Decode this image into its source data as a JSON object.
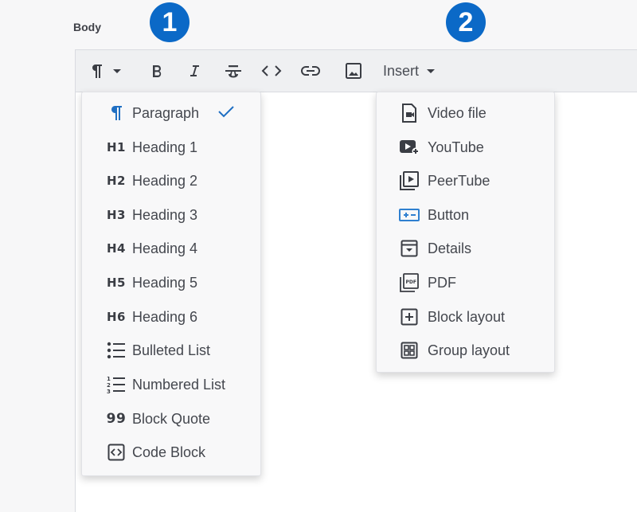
{
  "field": {
    "label": "Body"
  },
  "badges": [
    "1",
    "2"
  ],
  "toolbar": {
    "insert_label": "Insert",
    "buttons": [
      "paragraph-format-dropdown",
      "bold",
      "italic",
      "strikethrough",
      "inline-code",
      "link",
      "image",
      "insert-dropdown"
    ]
  },
  "format_menu": {
    "selected": "Paragraph",
    "items": [
      {
        "label": "Paragraph",
        "icon": "pilcrow-icon",
        "selected": true
      },
      {
        "label": "Heading 1",
        "icon": "H1"
      },
      {
        "label": "Heading 2",
        "icon": "H2"
      },
      {
        "label": "Heading 3",
        "icon": "H3"
      },
      {
        "label": "Heading 4",
        "icon": "H4"
      },
      {
        "label": "Heading 5",
        "icon": "H5"
      },
      {
        "label": "Heading 6",
        "icon": "H6"
      },
      {
        "label": "Bulleted List",
        "icon": "bulleted-list-icon"
      },
      {
        "label": "Numbered List",
        "icon": "numbered-list-icon"
      },
      {
        "label": "Block Quote",
        "icon": "99"
      },
      {
        "label": "Code Block",
        "icon": "code-block-icon"
      }
    ]
  },
  "insert_menu": {
    "items": [
      {
        "label": "Video file",
        "icon": "video-file-icon"
      },
      {
        "label": "YouTube",
        "icon": "youtube-icon"
      },
      {
        "label": "PeerTube",
        "icon": "peertube-icon"
      },
      {
        "label": "Button",
        "icon": "button-icon"
      },
      {
        "label": "Details",
        "icon": "details-icon"
      },
      {
        "label": "PDF",
        "icon": "pdf-icon"
      },
      {
        "label": "Block layout",
        "icon": "block-layout-icon"
      },
      {
        "label": "Group layout",
        "icon": "group-layout-icon"
      }
    ]
  },
  "colors": {
    "accent": "#0b69c7",
    "button_icon": "#2f80d0",
    "text": "#44474e"
  }
}
